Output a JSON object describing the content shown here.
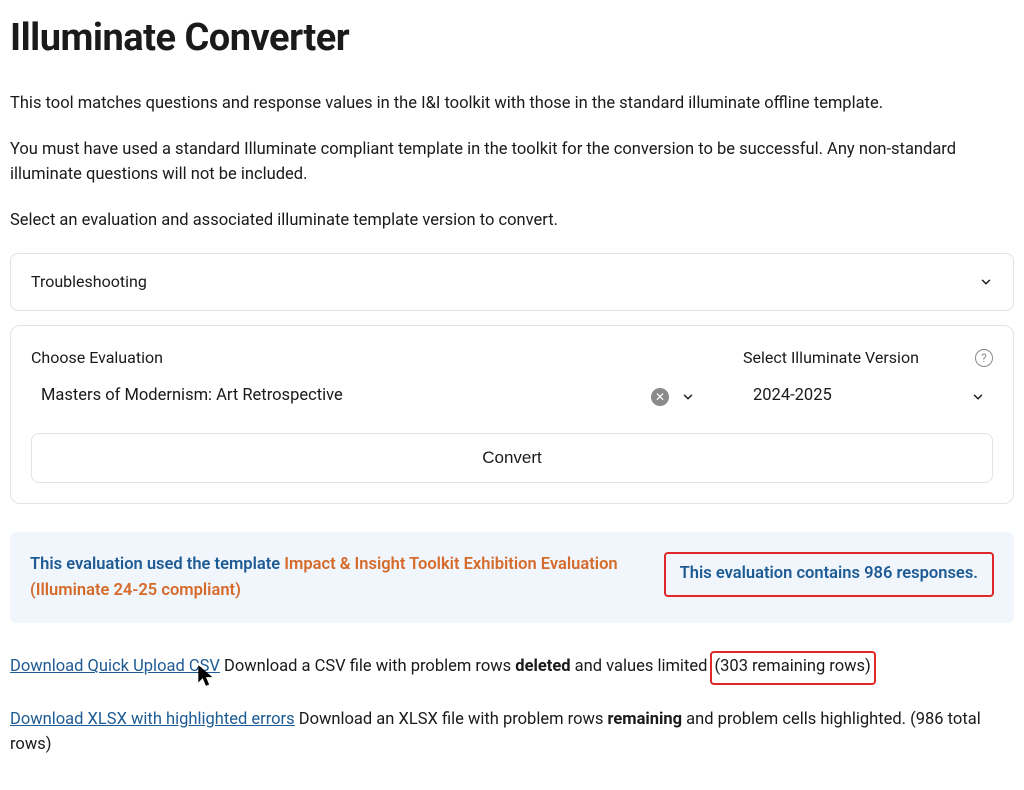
{
  "header": {
    "title": "Illuminate Converter"
  },
  "intro": {
    "p1": "This tool matches questions and response values in the I&I toolkit with those in the standard illuminate offline template.",
    "p2": "You must have used a standard Illuminate compliant template in the toolkit for the conversion to be successful. Any non-standard illuminate questions will not be included.",
    "p3": "Select an evaluation and associated illuminate template version to convert."
  },
  "accordion": {
    "label": "Troubleshooting"
  },
  "form": {
    "eval_label": "Choose Evaluation",
    "eval_value": "Masters of Modernism: Art Retrospective",
    "version_label": "Select Illuminate Version",
    "version_value": "2024-2025",
    "convert_label": "Convert"
  },
  "summary": {
    "prefix": "This evaluation used the template ",
    "template_name": "Impact & Insight Toolkit Exhibition Evaluation (Illuminate 24-25 compliant)",
    "response_count": "This evaluation contains 986 responses."
  },
  "downloads": {
    "csv_link": "Download Quick Upload CSV",
    "csv_desc_pre": " Download a CSV file with problem rows ",
    "csv_bold": "deleted",
    "csv_desc_mid": " and values limited ",
    "csv_remaining": "(303 remaining rows)",
    "xlsx_link": "Download XLSX with highlighted errors",
    "xlsx_desc_pre": " Download an XLSX file with problem rows ",
    "xlsx_bold": "remaining",
    "xlsx_desc_post": " and problem cells highlighted. (986 total rows)"
  }
}
